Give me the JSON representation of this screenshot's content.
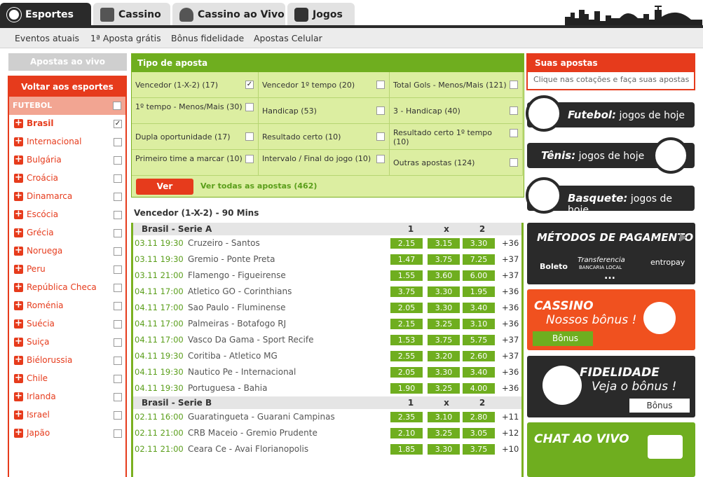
{
  "top_tabs": [
    "Esportes",
    "Cassino",
    "Cassino ao Vivo",
    "Jogos"
  ],
  "subnav": [
    "Eventos atuais",
    "1ª Aposta grátis",
    "Bônus fidelidade",
    "Apostas Celular"
  ],
  "left": {
    "live_label": "Apostas ao vivo",
    "back_label": "Voltar aos esportes",
    "section": "FUTEBOL",
    "countries": [
      "Brasil",
      "Internacional",
      "Bulgária",
      "Croácia",
      "Dinamarca",
      "Escócia",
      "Grécia",
      "Noruega",
      "Peru",
      "República Checa",
      "Roménia",
      "Suécia",
      "Suiça",
      "Biélorussia",
      "Chile",
      "Irlanda",
      "Israel",
      "Japão"
    ]
  },
  "tipo": {
    "title": "Tipo de aposta",
    "options": [
      "Vencedor (1-X-2) (17)",
      "Vencedor 1º tempo (20)",
      "Total Gols - Menos/Mais (121)",
      "1º tempo - Menos/Mais (30)",
      "Handicap (53)",
      "3 - Handicap (40)",
      "Dupla oportunidade (17)",
      "Resultado certo (10)",
      "Resultado certo 1º tempo (10)",
      "Primeiro time a marcar (10)",
      "Intervalo / Final do jogo (10)",
      "Outras apostas (124)"
    ],
    "ver": "Ver",
    "ver_todas": "Ver todas as apostas (462)"
  },
  "section_title": "Vencedor (1-X-2) - 90 Mins",
  "leagues": [
    {
      "name": "Brasil - Serie A",
      "h1": "1",
      "hx": "x",
      "h2": "2",
      "matches": [
        {
          "date": "03.11 19:30",
          "teams": "Cruzeiro - Santos",
          "o1": "2.15",
          "ox": "3.15",
          "o2": "3.30",
          "more": "+36"
        },
        {
          "date": "03.11 19:30",
          "teams": "Gremio - Ponte Preta",
          "o1": "1.47",
          "ox": "3.75",
          "o2": "7.25",
          "more": "+37"
        },
        {
          "date": "03.11 21:00",
          "teams": "Flamengo - Figueirense",
          "o1": "1.55",
          "ox": "3.60",
          "o2": "6.00",
          "more": "+37"
        },
        {
          "date": "04.11 17:00",
          "teams": "Atletico GO - Corinthians",
          "o1": "3.75",
          "ox": "3.30",
          "o2": "1.95",
          "more": "+36"
        },
        {
          "date": "04.11 17:00",
          "teams": "Sao Paulo - Fluminense",
          "o1": "2.05",
          "ox": "3.30",
          "o2": "3.40",
          "more": "+36"
        },
        {
          "date": "04.11 17:00",
          "teams": "Palmeiras - Botafogo RJ",
          "o1": "2.15",
          "ox": "3.25",
          "o2": "3.10",
          "more": "+36"
        },
        {
          "date": "04.11 17:00",
          "teams": "Vasco Da Gama - Sport Recife",
          "o1": "1.53",
          "ox": "3.75",
          "o2": "5.75",
          "more": "+37"
        },
        {
          "date": "04.11 19:30",
          "teams": "Coritiba - Atletico MG",
          "o1": "2.55",
          "ox": "3.20",
          "o2": "2.60",
          "more": "+37"
        },
        {
          "date": "04.11 19:30",
          "teams": "Nautico Pe - Internacional",
          "o1": "2.05",
          "ox": "3.30",
          "o2": "3.40",
          "more": "+36"
        },
        {
          "date": "04.11 19:30",
          "teams": "Portuguesa - Bahia",
          "o1": "1.90",
          "ox": "3.25",
          "o2": "4.00",
          "more": "+36"
        }
      ]
    },
    {
      "name": "Brasil - Serie B",
      "h1": "1",
      "hx": "x",
      "h2": "2",
      "matches": [
        {
          "date": "02.11 16:00",
          "teams": "Guaratingueta - Guarani Campinas",
          "o1": "2.35",
          "ox": "3.10",
          "o2": "2.80",
          "more": "+11"
        },
        {
          "date": "02.11 21:00",
          "teams": "CRB Maceio - Gremio Prudente",
          "o1": "2.10",
          "ox": "3.25",
          "o2": "3.05",
          "more": "+12"
        },
        {
          "date": "02.11 21:00",
          "teams": "Ceara Ce - Avai Florianopolis",
          "o1": "1.85",
          "ox": "3.30",
          "o2": "3.75",
          "more": "+10"
        }
      ]
    }
  ],
  "right": {
    "suas_title": "Suas apostas",
    "suas_sub": "Clique nas cotações e faça suas apostas",
    "futebol": {
      "b": "Futebol:",
      "t": "jogos de hoje"
    },
    "tenis": {
      "b": "Tênis:",
      "t": "jogos de hoje"
    },
    "basquete": {
      "b": "Basquete:",
      "t": "jogos de hoje"
    },
    "pagamento": "MÉTODOS DE PAGAMENTO",
    "pay_logos": [
      "Boleto",
      "Transferencia",
      "BANCARIA LOCAL",
      "entropay"
    ],
    "pay_more": "...",
    "cassino": "CASSINO",
    "cassino_sub": "Nossos bônus !",
    "cassino_btn": "Bônus",
    "fidelidade": "FIDELIDADE",
    "fidelidade_sub": "Veja o bônus !",
    "fidelidade_btn": "Bônus",
    "chat": "CHAT AO VIVO"
  }
}
